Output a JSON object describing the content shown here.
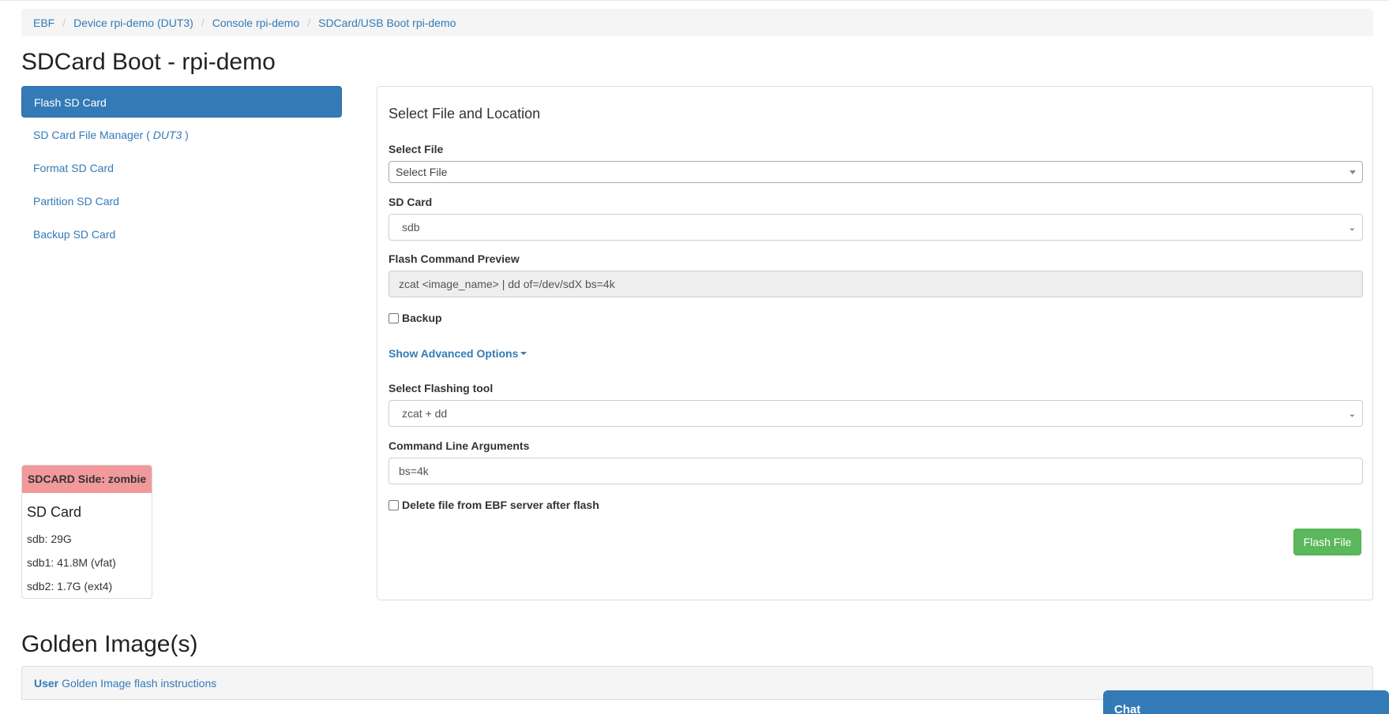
{
  "breadcrumb": {
    "items": [
      "EBF",
      "Device rpi-demo (DUT3)",
      "Console rpi-demo",
      "SDCard/USB Boot rpi-demo"
    ],
    "separator": "/"
  },
  "page_title": "SDCard Boot - rpi-demo",
  "sidebar": {
    "items": [
      {
        "label": "Flash SD Card",
        "active": true
      },
      {
        "label_prefix": "SD Card File Manager ( ",
        "label_em": "DUT3",
        "label_suffix": " )"
      },
      {
        "label": "Format SD Card"
      },
      {
        "label": "Partition SD Card"
      },
      {
        "label": "Backup SD Card"
      }
    ]
  },
  "sd_status": {
    "heading": "SDCARD Side: zombie",
    "title": "SD Card",
    "lines": [
      "sdb: 29G",
      "sdb1: 41.8M (vfat)",
      "sdb2: 1.7G (ext4)"
    ],
    "heading_color": "#f2999b"
  },
  "form": {
    "section_title": "Select File and Location",
    "select_file": {
      "label": "Select File",
      "value": "Select File"
    },
    "sd_card": {
      "label": "SD Card",
      "value": "sdb"
    },
    "flash_command_preview": {
      "label": "Flash Command Preview",
      "value": "zcat <image_name> | dd of=/dev/sdX bs=4k"
    },
    "backup": {
      "label": "Backup",
      "checked": false
    },
    "advanced_link": "Show Advanced Options",
    "flashing_tool": {
      "label": "Select Flashing tool",
      "value": "zcat + dd"
    },
    "cmd_args": {
      "label": "Command Line Arguments",
      "value": "bs=4k"
    },
    "delete_after": {
      "label": "Delete file from EBF server after flash",
      "checked": false
    },
    "flash_button": "Flash File"
  },
  "golden": {
    "title": "Golden Image(s)",
    "panel_strong": "User",
    "panel_text": "Golden Image flash instructions"
  },
  "chat": {
    "label": "Chat"
  },
  "colors": {
    "primary": "#337ab7",
    "success": "#5cb85c",
    "danger_light": "#f2999b"
  }
}
